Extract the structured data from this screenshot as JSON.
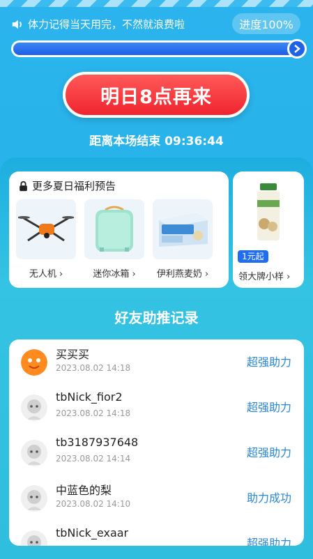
{
  "notice": {
    "text": "体力记得当天用完，不然就浪费啦"
  },
  "progress": {
    "label": "进度100%",
    "fill_fraction": 1.0
  },
  "cta": {
    "label": "明日8点再来"
  },
  "countdown": {
    "text": "距离本场结束 09:36:44"
  },
  "preview_card": {
    "title": "更多夏日福利预告",
    "products": [
      {
        "label": "无人机 ›"
      },
      {
        "label": "迷你冰箱 ›"
      },
      {
        "label": "伊利燕麦奶 ›"
      }
    ]
  },
  "side_card": {
    "tag": "1元起",
    "label": "领大牌小样 ›"
  },
  "records": {
    "title": "好友助推记录",
    "rows": [
      {
        "name": "买买买",
        "time": "2023.08.02 14:18",
        "status": "超强助力"
      },
      {
        "name": "tbNick_fior2",
        "time": "2023.08.02 14:18",
        "status": "超强助力"
      },
      {
        "name": "tb3187937648",
        "time": "2023.08.02 14:14",
        "status": "超强助力"
      },
      {
        "name": "中蓝色的梨",
        "time": "2023.08.02 14:10",
        "status": "助力成功"
      },
      {
        "name": "tbNick_exaar",
        "time": "",
        "status": "超强助力"
      }
    ]
  },
  "colors": {
    "cta": "#f0242f",
    "status": "#2a86d6",
    "progress": "#1d5fe6"
  }
}
